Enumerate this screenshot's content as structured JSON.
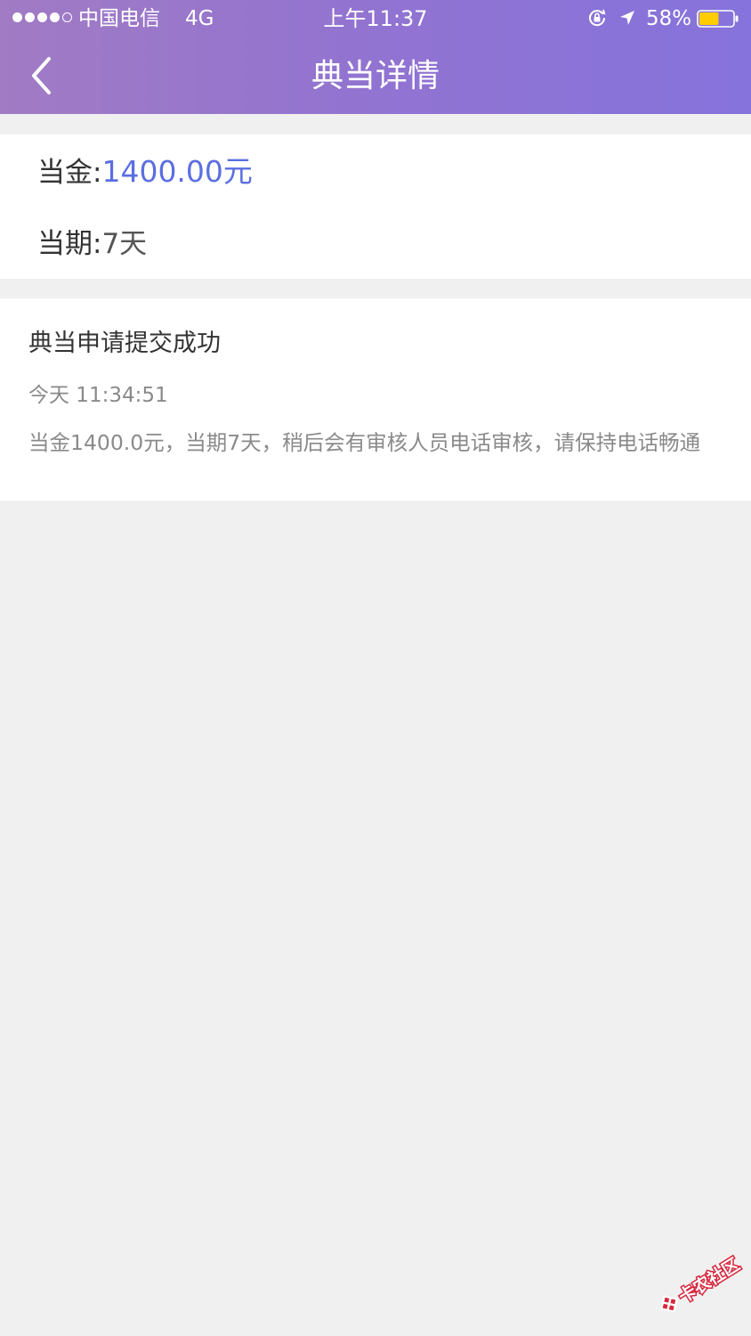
{
  "status_bar": {
    "carrier": "中国电信",
    "network": "4G",
    "time": "上午11:37",
    "battery_percent": "58%",
    "battery_level": 0.58,
    "battery_color": "#ffcc00",
    "icons": [
      "signal-dots",
      "lock-rotation-icon",
      "location-icon",
      "battery-icon"
    ]
  },
  "header": {
    "back_icon": "chevron-left-icon",
    "title": "典当详情"
  },
  "summary": {
    "amount_label": "当金:",
    "amount_value": "1400.00元",
    "term_label": "当期:",
    "term_value": "7天"
  },
  "record": {
    "title": "典当申请提交成功",
    "time": "今天 11:34:51",
    "description": "当金1400.0元，当期7天，稍后会有审核人员电话审核，请保持电话畅通"
  },
  "colors": {
    "header_gradient_start": "#a17bc4",
    "header_gradient_end": "#8673dc",
    "amount_color": "#5b6ee1",
    "background": "#f0f0f0"
  },
  "watermark": {
    "text": "卡农社区"
  }
}
